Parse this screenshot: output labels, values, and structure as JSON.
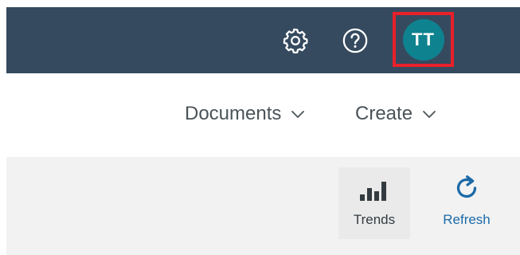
{
  "header": {
    "avatar_initials": "TT",
    "colors": {
      "bar": "#354a5f",
      "avatar": "#0f828f",
      "highlight": "#e8202a"
    },
    "icons": {
      "settings": "gear-icon",
      "help": "help-icon"
    }
  },
  "menus": {
    "documents_label": "Documents",
    "create_label": "Create"
  },
  "toolbar": {
    "trends_label": "Trends",
    "refresh_label": "Refresh",
    "icons": {
      "trends": "bar-chart-icon",
      "refresh": "refresh-icon"
    }
  }
}
